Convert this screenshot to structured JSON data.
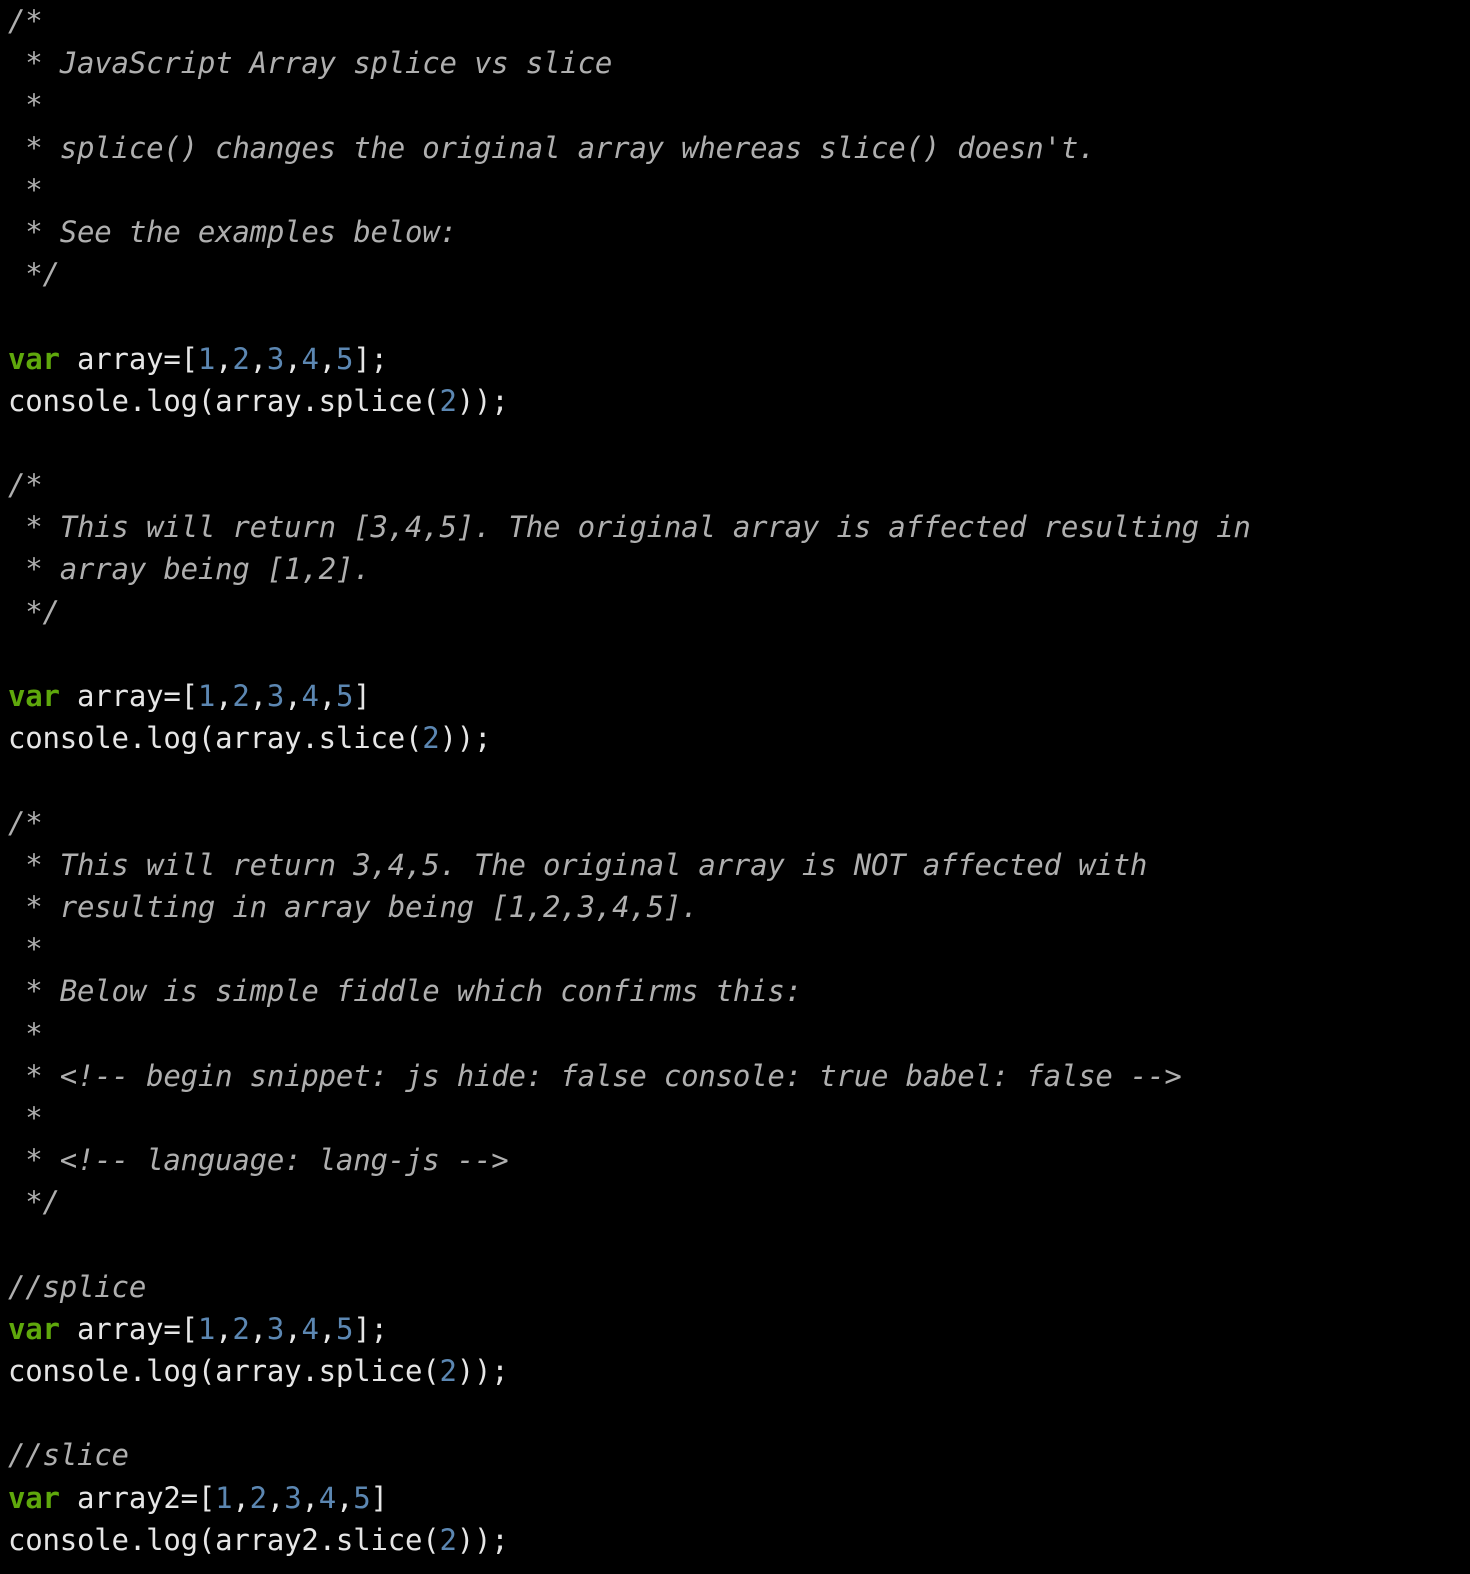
{
  "editor": {
    "title": "JavaScript Array splice vs slice",
    "language": "javascript",
    "background_color": "#000000",
    "colors": {
      "plain": "#e6e6e6",
      "comment": "#afafaf",
      "keyword": "#5fa80c",
      "number": "#5c87b2"
    }
  },
  "lines": [
    {
      "type": "comment",
      "text": "/*"
    },
    {
      "type": "comment",
      "text": " * JavaScript Array splice vs slice"
    },
    {
      "type": "comment",
      "text": " *"
    },
    {
      "type": "comment",
      "text": " * splice() changes the original array whereas slice() doesn't."
    },
    {
      "type": "comment",
      "text": " *"
    },
    {
      "type": "comment",
      "text": " * See the examples below:"
    },
    {
      "type": "comment",
      "text": " */"
    },
    {
      "type": "blank",
      "text": ""
    },
    {
      "type": "code",
      "tokens": [
        {
          "kind": "keyword",
          "text": "var"
        },
        {
          "kind": "plain",
          "text": " array=["
        },
        {
          "kind": "number",
          "text": "1"
        },
        {
          "kind": "plain",
          "text": ","
        },
        {
          "kind": "number",
          "text": "2"
        },
        {
          "kind": "plain",
          "text": ","
        },
        {
          "kind": "number",
          "text": "3"
        },
        {
          "kind": "plain",
          "text": ","
        },
        {
          "kind": "number",
          "text": "4"
        },
        {
          "kind": "plain",
          "text": ","
        },
        {
          "kind": "number",
          "text": "5"
        },
        {
          "kind": "plain",
          "text": "];"
        }
      ]
    },
    {
      "type": "code",
      "tokens": [
        {
          "kind": "plain",
          "text": "console.log(array.splice("
        },
        {
          "kind": "number",
          "text": "2"
        },
        {
          "kind": "plain",
          "text": "));"
        }
      ]
    },
    {
      "type": "blank",
      "text": ""
    },
    {
      "type": "comment",
      "text": "/*"
    },
    {
      "type": "comment",
      "text": " * This will return [3,4,5]. The original array is affected resulting in"
    },
    {
      "type": "comment",
      "text": " * array being [1,2]."
    },
    {
      "type": "comment",
      "text": " */"
    },
    {
      "type": "blank",
      "text": ""
    },
    {
      "type": "code",
      "tokens": [
        {
          "kind": "keyword",
          "text": "var"
        },
        {
          "kind": "plain",
          "text": " array=["
        },
        {
          "kind": "number",
          "text": "1"
        },
        {
          "kind": "plain",
          "text": ","
        },
        {
          "kind": "number",
          "text": "2"
        },
        {
          "kind": "plain",
          "text": ","
        },
        {
          "kind": "number",
          "text": "3"
        },
        {
          "kind": "plain",
          "text": ","
        },
        {
          "kind": "number",
          "text": "4"
        },
        {
          "kind": "plain",
          "text": ","
        },
        {
          "kind": "number",
          "text": "5"
        },
        {
          "kind": "plain",
          "text": "]"
        }
      ]
    },
    {
      "type": "code",
      "tokens": [
        {
          "kind": "plain",
          "text": "console.log(array.slice("
        },
        {
          "kind": "number",
          "text": "2"
        },
        {
          "kind": "plain",
          "text": "));"
        }
      ]
    },
    {
      "type": "blank",
      "text": ""
    },
    {
      "type": "comment",
      "text": "/*"
    },
    {
      "type": "comment",
      "text": " * This will return 3,4,5. The original array is NOT affected with"
    },
    {
      "type": "comment",
      "text": " * resulting in array being [1,2,3,4,5]."
    },
    {
      "type": "comment",
      "text": " *"
    },
    {
      "type": "comment",
      "text": " * Below is simple fiddle which confirms this:"
    },
    {
      "type": "comment",
      "text": " *"
    },
    {
      "type": "comment",
      "text": " * <!-- begin snippet: js hide: false console: true babel: false -->"
    },
    {
      "type": "comment",
      "text": " *"
    },
    {
      "type": "comment",
      "text": " * <!-- language: lang-js -->"
    },
    {
      "type": "comment",
      "text": " */"
    },
    {
      "type": "blank",
      "text": ""
    },
    {
      "type": "comment",
      "text": "//splice"
    },
    {
      "type": "code",
      "tokens": [
        {
          "kind": "keyword",
          "text": "var"
        },
        {
          "kind": "plain",
          "text": " array=["
        },
        {
          "kind": "number",
          "text": "1"
        },
        {
          "kind": "plain",
          "text": ","
        },
        {
          "kind": "number",
          "text": "2"
        },
        {
          "kind": "plain",
          "text": ","
        },
        {
          "kind": "number",
          "text": "3"
        },
        {
          "kind": "plain",
          "text": ","
        },
        {
          "kind": "number",
          "text": "4"
        },
        {
          "kind": "plain",
          "text": ","
        },
        {
          "kind": "number",
          "text": "5"
        },
        {
          "kind": "plain",
          "text": "];"
        }
      ]
    },
    {
      "type": "code",
      "tokens": [
        {
          "kind": "plain",
          "text": "console.log(array.splice("
        },
        {
          "kind": "number",
          "text": "2"
        },
        {
          "kind": "plain",
          "text": "));"
        }
      ]
    },
    {
      "type": "blank",
      "text": ""
    },
    {
      "type": "comment",
      "text": "//slice"
    },
    {
      "type": "code",
      "tokens": [
        {
          "kind": "keyword",
          "text": "var"
        },
        {
          "kind": "plain",
          "text": " array2=["
        },
        {
          "kind": "number",
          "text": "1"
        },
        {
          "kind": "plain",
          "text": ","
        },
        {
          "kind": "number",
          "text": "2"
        },
        {
          "kind": "plain",
          "text": ","
        },
        {
          "kind": "number",
          "text": "3"
        },
        {
          "kind": "plain",
          "text": ","
        },
        {
          "kind": "number",
          "text": "4"
        },
        {
          "kind": "plain",
          "text": ","
        },
        {
          "kind": "number",
          "text": "5"
        },
        {
          "kind": "plain",
          "text": "]"
        }
      ]
    },
    {
      "type": "code",
      "tokens": [
        {
          "kind": "plain",
          "text": "console.log(array2.slice("
        },
        {
          "kind": "number",
          "text": "2"
        },
        {
          "kind": "plain",
          "text": "));"
        }
      ]
    }
  ]
}
